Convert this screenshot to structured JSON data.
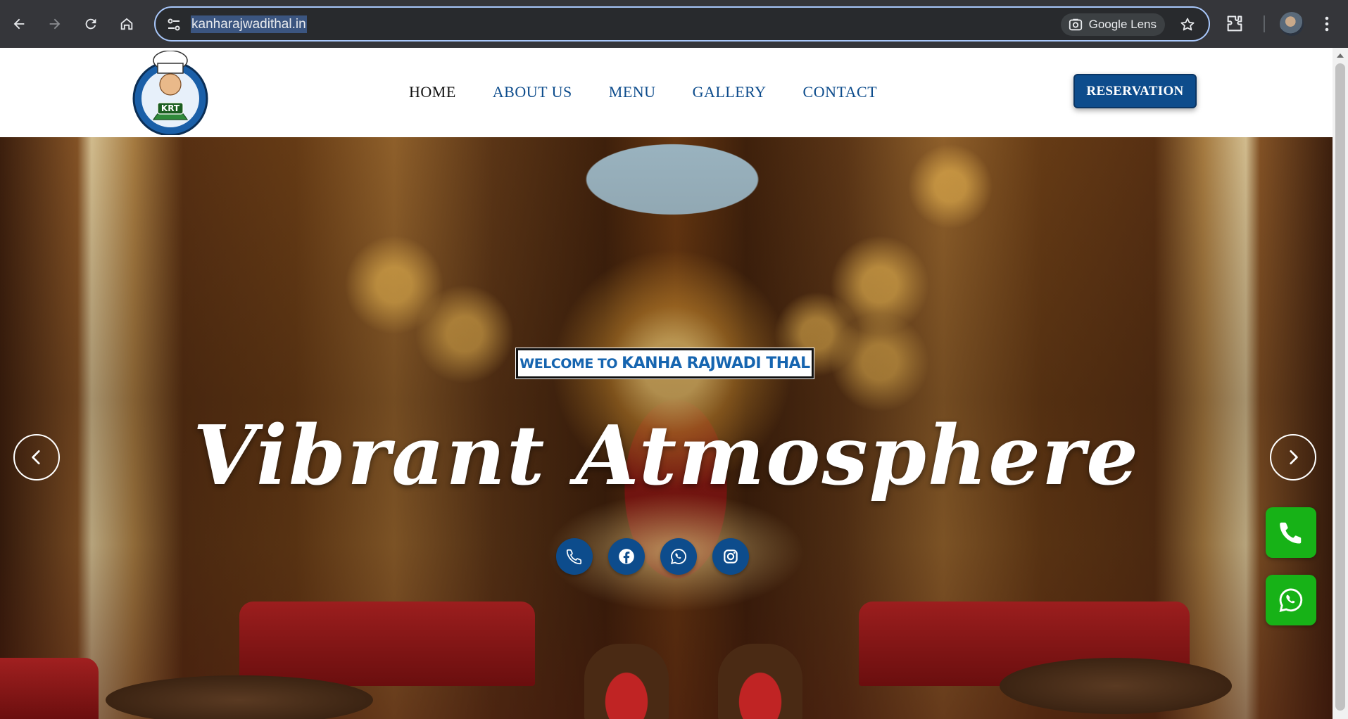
{
  "browser": {
    "url": "kanharajwadithal.in",
    "lens_label": "Google Lens"
  },
  "header": {
    "logo_text": "KRT",
    "nav": [
      {
        "label": "HOME"
      },
      {
        "label": "ABOUT US"
      },
      {
        "label": "MENU"
      },
      {
        "label": "GALLERY"
      },
      {
        "label": "CONTACT"
      }
    ],
    "reservation_label": "RESERVATION"
  },
  "hero": {
    "welcome_prefix": "WELCOME TO",
    "welcome_name": "KANHA RAJWADI THAL",
    "title": "Vibrant Atmosphere"
  },
  "colors": {
    "brand_blue": "#0d4c8c",
    "whatsapp_green": "#17b217",
    "chrome_dark": "#35363a"
  },
  "icons": {
    "social": [
      "phone-icon",
      "facebook-icon",
      "whatsapp-icon",
      "instagram-icon"
    ],
    "floating": [
      "phone-icon",
      "whatsapp-icon"
    ]
  }
}
